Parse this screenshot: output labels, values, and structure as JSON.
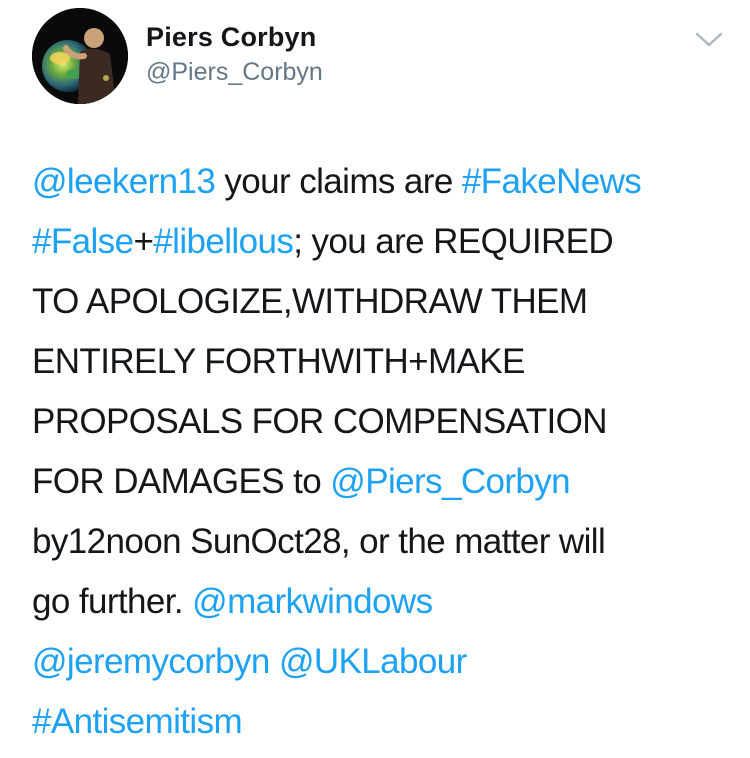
{
  "colors": {
    "link": "#1da1f2",
    "text": "#14171a",
    "secondary": "#657786",
    "caret": "#aab8c2"
  },
  "author": {
    "name": "Piers Corbyn",
    "handle": "@Piers_Corbyn"
  },
  "menu": {
    "icon": "chevron-down-icon"
  },
  "tweet": {
    "lines": [
      {
        "seg": [
          "@leekern13",
          " your claims are ",
          "#FakeNews"
        ]
      },
      {
        "seg": [
          "#False",
          "+",
          "#libellous",
          "; you are REQUIRED"
        ]
      },
      {
        "seg": [
          "TO APOLOGIZE,WITHDRAW THEM"
        ]
      },
      {
        "seg": [
          "ENTIRELY FORTHWITH+MAKE"
        ]
      },
      {
        "seg": [
          "PROPOSALS FOR COMPENSATION"
        ]
      },
      {
        "seg": [
          "FOR DAMAGES to ",
          "@Piers_Corbyn"
        ]
      },
      {
        "seg": [
          "by12noon SunOct28, or the matter will"
        ]
      },
      {
        "seg": [
          "go further. ",
          "@markwindows"
        ]
      },
      {
        "seg": [
          "@jeremycorbyn",
          " ",
          "@UKLabour"
        ]
      },
      {
        "seg": [
          "#Antisemitism"
        ]
      }
    ]
  }
}
